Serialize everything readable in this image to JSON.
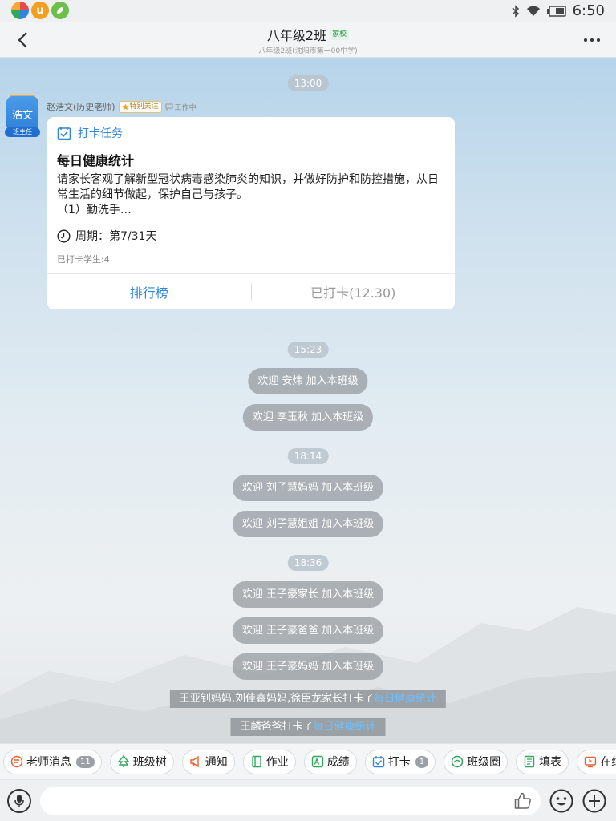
{
  "status_bar": {
    "time": "6:50",
    "app_icon_letter": "u"
  },
  "header": {
    "title": "八年级2班",
    "tag": "家校",
    "subtitle": "八年级2班(沈阳市第一00中学)"
  },
  "messages": {
    "t1": "13:00",
    "sender": {
      "avatar_text": "浩文",
      "avatar_badge": "班主任",
      "name": "赵浩文(历史老师)",
      "special_tag": "特别关注",
      "status": "工作中"
    },
    "card": {
      "type_label": "打卡任务",
      "title": "每日健康统计",
      "body": "请家长客观了解新型冠状病毒感染肺炎的知识，并做好防护和防控措施，从日常生活的细节做起，保护自己与孩子。",
      "body_line3": "（1）勤洗手…",
      "period": "周期：第7/31天",
      "count": "已打卡学生:4",
      "rank_label": "排行榜",
      "checked_label": "已打卡(12.30)"
    },
    "t2": "15:23",
    "w1": "欢迎 安炜 加入本班级",
    "w2": "欢迎 李玉秋 加入本班级",
    "t3": "18:14",
    "w3": "欢迎 刘子慧妈妈 加入本班级",
    "w4": "欢迎 刘子慧姐姐 加入本班级",
    "t4": "18:36",
    "w5": "欢迎 王子豪家长 加入本班级",
    "w6": "欢迎 王子豪爸爸 加入本班级",
    "w7": "欢迎 王子豪妈妈 加入本班级",
    "c1_prefix": "王亚钊妈妈,刘佳鑫妈妈,徐臣龙家长打卡了",
    "c1_link": "每日健康统计",
    "c2_prefix": "王麟爸爸打卡了",
    "c2_link": "每日健康统计"
  },
  "quick_bar": [
    {
      "label": "老师消息",
      "badge": "11",
      "icon": "teacher-message-icon",
      "color": "#e8602c"
    },
    {
      "label": "班级树",
      "badge": "",
      "icon": "class-tree-icon",
      "color": "#2ea85a"
    },
    {
      "label": "通知",
      "badge": "",
      "icon": "megaphone-icon",
      "color": "#e8602c"
    },
    {
      "label": "作业",
      "badge": "",
      "icon": "homework-icon",
      "color": "#2ea85a"
    },
    {
      "label": "成绩",
      "badge": "",
      "icon": "grades-icon",
      "color": "#2ea85a"
    },
    {
      "label": "打卡",
      "badge": "1",
      "icon": "checkin-icon",
      "color": "#2f86dc"
    },
    {
      "label": "班级圈",
      "badge": "",
      "icon": "class-circle-icon",
      "color": "#2ea85a"
    },
    {
      "label": "填表",
      "badge": "",
      "icon": "form-icon",
      "color": "#2ea85a"
    },
    {
      "label": "在线课堂",
      "badge": "",
      "icon": "online-class-icon",
      "color": "#e8602c"
    }
  ],
  "input": {
    "value": "",
    "placeholder": ""
  },
  "colors": {
    "accent": "#2f86dc",
    "link": "#6fc0ff"
  }
}
